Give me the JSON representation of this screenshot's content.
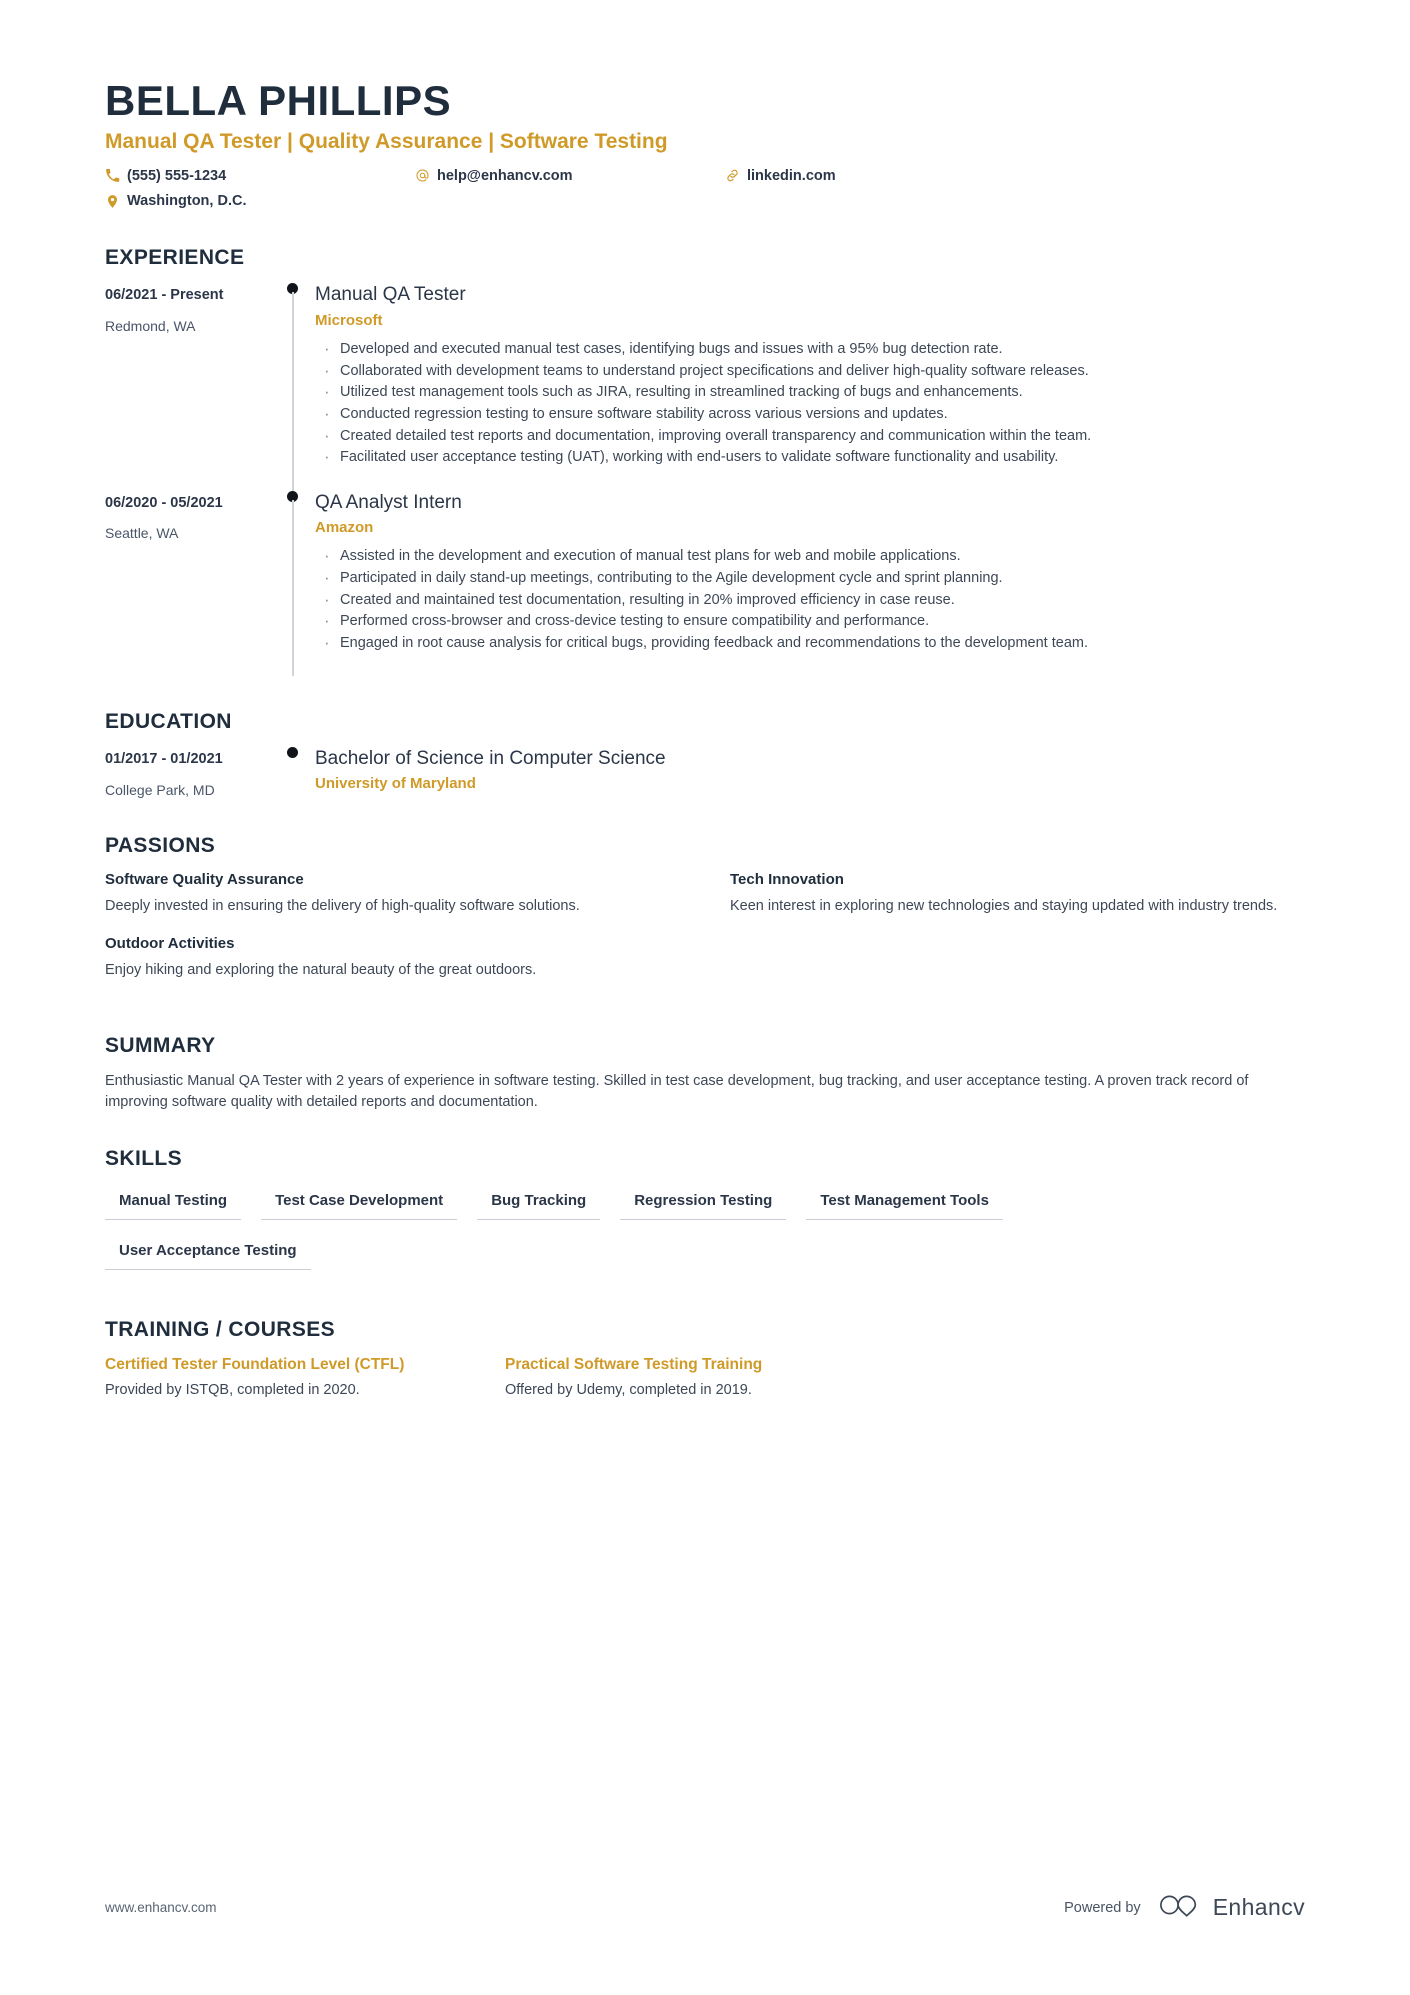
{
  "header": {
    "name": "BELLA PHILLIPS",
    "headline": "Manual QA Tester | Quality Assurance | Software Testing",
    "contacts": {
      "phone": "(555) 555-1234",
      "location": "Washington, D.C.",
      "email": "help@enhancv.com",
      "linkedin": "linkedin.com"
    },
    "icons": {
      "phone": "phone-icon",
      "location": "location-pin-icon",
      "email": "at-sign-icon",
      "linkedin": "link-icon"
    }
  },
  "colors": {
    "accent": "#d09a28",
    "heading": "#1f2d3d",
    "body": "#3d4756",
    "rail_line": "#cfd4da",
    "dot": "#111418"
  },
  "sections": {
    "experience_title": "EXPERIENCE",
    "education_title": "EDUCATION",
    "passions_title": "PASSIONS",
    "summary_title": "SUMMARY",
    "skills_title": "SKILLS",
    "training_title": "TRAINING / COURSES"
  },
  "experience": [
    {
      "date": "06/2021 - Present",
      "place": "Redmond, WA",
      "title": "Manual QA Tester",
      "organization": "Microsoft",
      "bullets": [
        "Developed and executed manual test cases, identifying bugs and issues with a 95% bug detection rate.",
        "Collaborated with development teams to understand project specifications and deliver high-quality software releases.",
        "Utilized test management tools such as JIRA, resulting in streamlined tracking of bugs and enhancements.",
        "Conducted regression testing to ensure software stability across various versions and updates.",
        "Created detailed test reports and documentation, improving overall transparency and communication within the team.",
        "Facilitated user acceptance testing (UAT), working with end-users to validate software functionality and usability."
      ]
    },
    {
      "date": "06/2020 - 05/2021",
      "place": "Seattle, WA",
      "title": "QA Analyst Intern",
      "organization": "Amazon",
      "bullets": [
        "Assisted in the development and execution of manual test plans for web and mobile applications.",
        "Participated in daily stand-up meetings, contributing to the Agile development cycle and sprint planning.",
        "Created and maintained test documentation, resulting in 20% improved efficiency in case reuse.",
        "Performed cross-browser and cross-device testing to ensure compatibility and performance.",
        "Engaged in root cause analysis for critical bugs, providing feedback and recommendations to the development team."
      ]
    }
  ],
  "education": [
    {
      "date": "01/2017 - 01/2021",
      "place": "College Park, MD",
      "degree": "Bachelor of Science in Computer Science",
      "school": "University of Maryland"
    }
  ],
  "passions": [
    {
      "title": "Software Quality Assurance",
      "description": "Deeply invested in ensuring the delivery of high-quality software solutions."
    },
    {
      "title": "Tech Innovation",
      "description": "Keen interest in exploring new technologies and staying updated with industry trends."
    },
    {
      "title": "Outdoor Activities",
      "description": "Enjoy hiking and exploring the natural beauty of the great outdoors."
    }
  ],
  "summary": "Enthusiastic Manual QA Tester with 2 years of experience in software testing. Skilled in test case development, bug tracking, and user acceptance testing. A proven track record of improving software quality with detailed reports and documentation.",
  "skills": [
    "Manual Testing",
    "Test Case Development",
    "Bug Tracking",
    "Regression Testing",
    "Test Management Tools",
    "User Acceptance Testing"
  ],
  "training": [
    {
      "title": "Certified Tester Foundation Level (CTFL)",
      "description": "Provided by ISTQB, completed in 2020."
    },
    {
      "title": "Practical Software Testing Training",
      "description": "Offered by Udemy, completed in 2019."
    }
  ],
  "footer": {
    "url": "www.enhancv.com",
    "powered_by": "Powered by",
    "brand": "Enhancv"
  }
}
